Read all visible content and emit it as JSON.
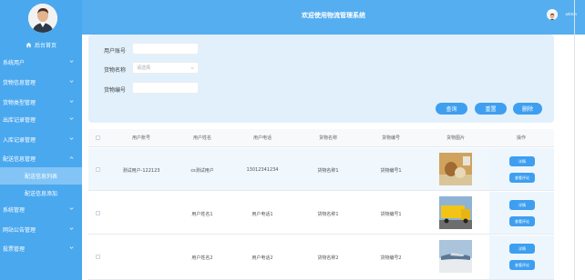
{
  "app": {
    "title": "欢迎使用物流管理系统",
    "username": "admin"
  },
  "sidebar": {
    "home_label": "后台首页",
    "items": [
      {
        "label": "系统用户"
      },
      {
        "label": "货物信息管理"
      },
      {
        "label": "货物类型管理"
      },
      {
        "label": "出库记录管理"
      },
      {
        "label": "入库记录管理"
      },
      {
        "label": "配送信息管理"
      },
      {
        "label": "系统管理"
      },
      {
        "label": "网站公告管理"
      },
      {
        "label": "投票管理"
      }
    ],
    "subitems": [
      {
        "label": "配送信息列表"
      },
      {
        "label": "配送信息添加"
      }
    ]
  },
  "search": {
    "account_label": "用户账号",
    "goods_name_label": "货物名称",
    "goods_name_placeholder": "请选择",
    "goods_no_label": "货物编号",
    "query_btn": "查询",
    "reset_btn": "重置",
    "delete_btn": "删除"
  },
  "table": {
    "headers": [
      "用户账号",
      "用户姓名",
      "用户电话",
      "货物名称",
      "货物编号",
      "货物图片",
      "操作"
    ],
    "rows": [
      {
        "account": "测试用户-122123",
        "name": "cs测试用户",
        "phone": "13012341234",
        "goods_name": "货物名称1",
        "goods_no": "货物编号1"
      },
      {
        "account": "",
        "name": "用户姓名1",
        "phone": "用户电话1",
        "goods_name": "货物名称1",
        "goods_no": "货物编号1"
      },
      {
        "account": "",
        "name": "用户姓名2",
        "phone": "用户电话2",
        "goods_name": "货物名称2",
        "goods_no": "货物编号2"
      }
    ],
    "detail_btn": "详情",
    "review_btn": "查看评论"
  },
  "colors": {
    "sidebar": "#4aa8ef",
    "header": "#54aef0",
    "button": "#3e9ff0",
    "panel": "#e2f0fb"
  }
}
